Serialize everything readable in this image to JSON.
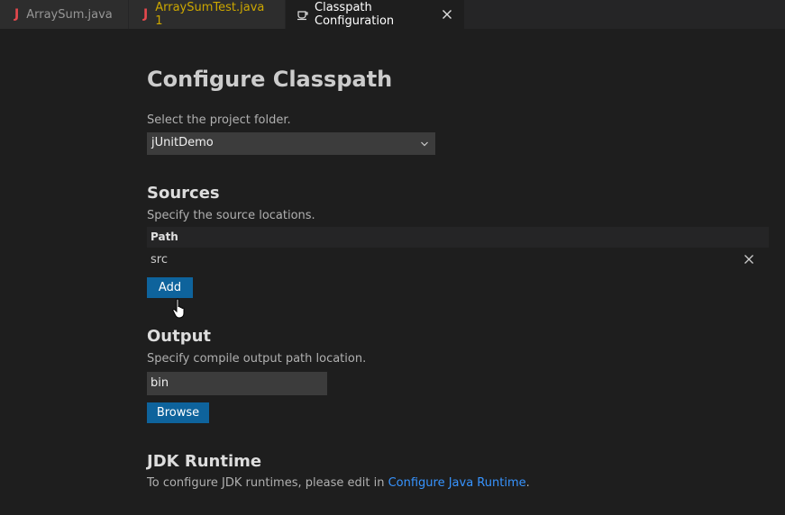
{
  "tabs": [
    {
      "label": "ArraySum.java",
      "icon": "java-file-icon"
    },
    {
      "label": "ArraySumTest.java 1",
      "icon": "java-file-icon",
      "state": "warning"
    },
    {
      "label": "Classpath Configuration",
      "icon": "coffee-cup-icon",
      "active": true
    }
  ],
  "page": {
    "title": "Configure Classpath",
    "project_prompt": "Select the project folder.",
    "project_selected": "jUnitDemo",
    "sources": {
      "heading": "Sources",
      "description": "Specify the source locations.",
      "column_header": "Path",
      "rows": [
        "src"
      ],
      "add_label": "Add"
    },
    "output": {
      "heading": "Output",
      "description": "Specify compile output path location.",
      "value": "bin",
      "browse_label": "Browse"
    },
    "jdk": {
      "heading": "JDK Runtime",
      "text_before": "To configure JDK runtimes, please edit in ",
      "link": "Configure Java Runtime",
      "text_after": "."
    }
  },
  "colors": {
    "background": "#1e1e1e",
    "button": "#0e639c",
    "link": "#3794ff",
    "java_icon": "#e5484d",
    "warning": "#cca700"
  }
}
